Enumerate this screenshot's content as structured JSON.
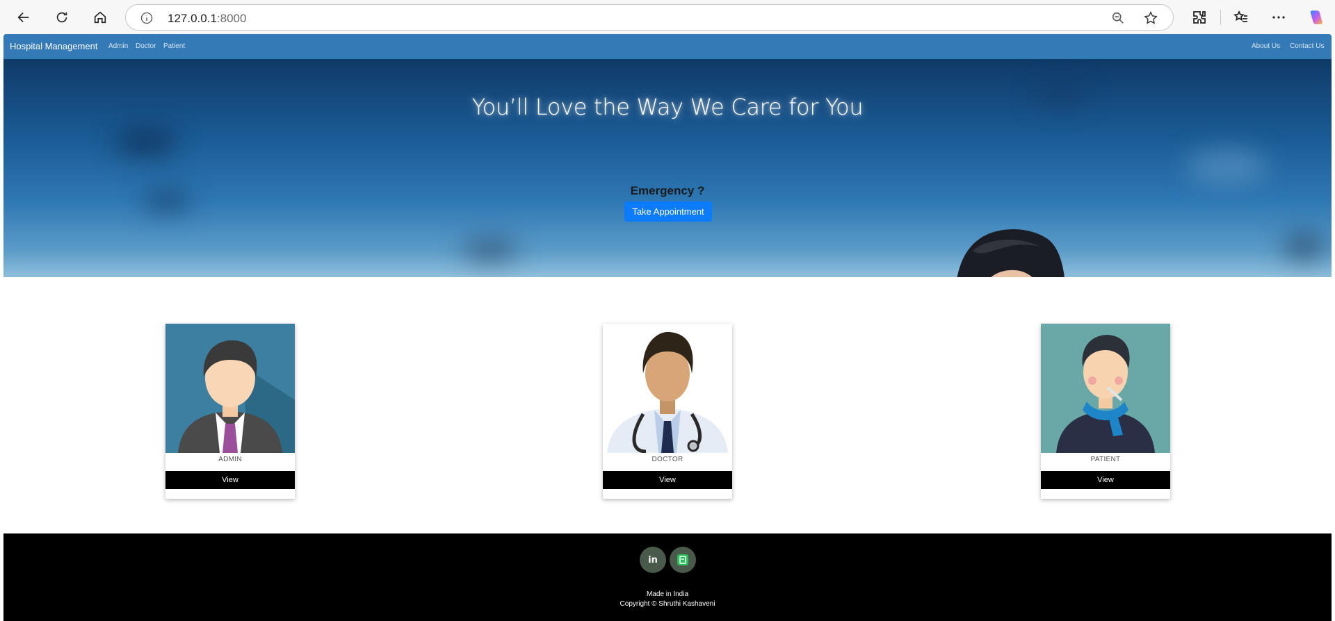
{
  "browser": {
    "url_host": "127.0.0.1",
    "url_port": ":8000",
    "icons": [
      "back-icon",
      "reload-icon",
      "home-icon",
      "info-icon",
      "zoom-out-icon",
      "star-icon",
      "extensions-icon",
      "favorites-icon",
      "more-icon",
      "copilot-icon"
    ]
  },
  "navbar": {
    "brand": "Hospital Management",
    "left_links": [
      "Admin",
      "Doctor",
      "Patient"
    ],
    "right_links": [
      "About Us",
      "Contact Us"
    ],
    "color": "#337ab7"
  },
  "hero": {
    "title": "You’ll Love the Way We Care for You",
    "emergency": "Emergency ?",
    "button": "Take Appointment",
    "button_color": "#0b7bff"
  },
  "cards": [
    {
      "label": "ADMIN",
      "button": "View"
    },
    {
      "label": "DOCTOR",
      "button": "View"
    },
    {
      "label": "PATIENT",
      "button": "View"
    }
  ],
  "footer": {
    "social_icons": [
      "linkedin-icon",
      "whatsapp-icon"
    ],
    "made_in": "Made in India",
    "copyright": "Copyright © Shruthi Kashaveni"
  }
}
